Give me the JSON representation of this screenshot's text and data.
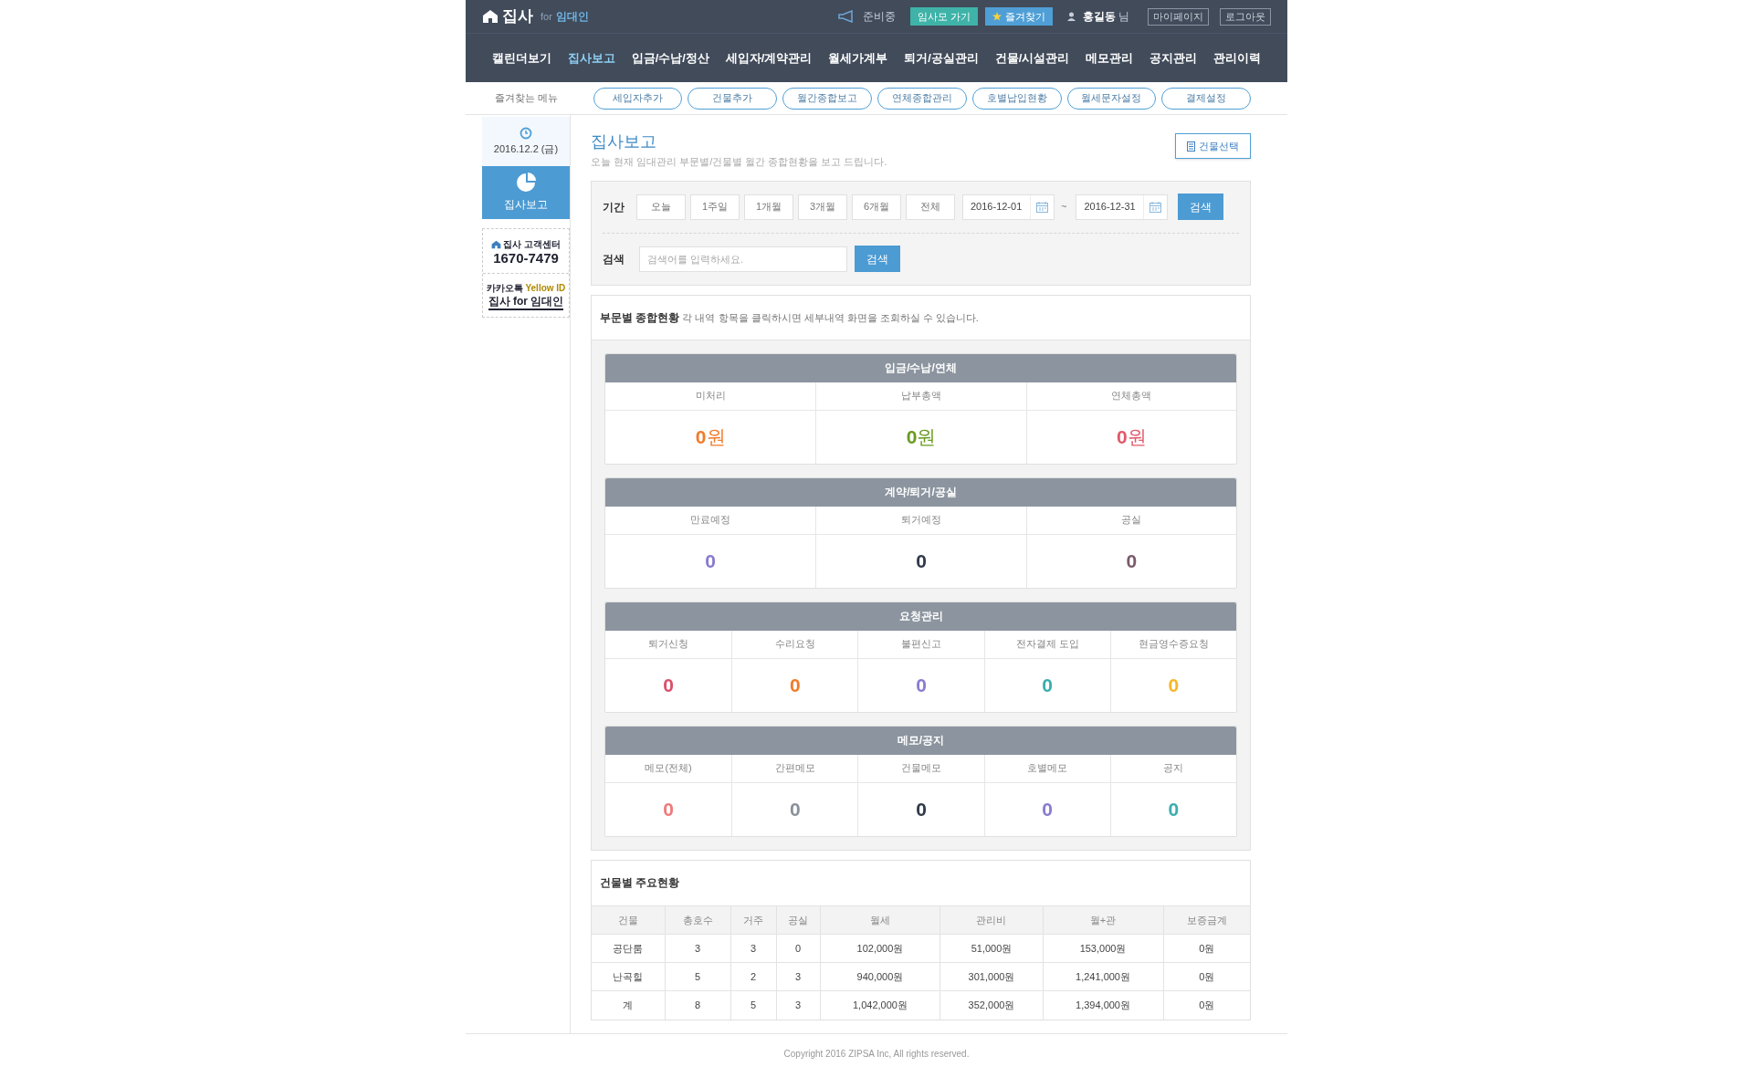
{
  "header": {
    "logo": {
      "main": "집사",
      "for": "for",
      "sub": "임대인"
    },
    "status": "준비중",
    "buttons": [
      {
        "label": "임사모 가기",
        "kind": "teal"
      },
      {
        "label": "즐겨찾기",
        "kind": "star"
      }
    ],
    "user": {
      "name": "홍길동",
      "suffix": "님"
    },
    "links": [
      "마이페이지",
      "로그아웃"
    ]
  },
  "nav": [
    {
      "label": "캘린더보기",
      "selected": false
    },
    {
      "label": "집사보고",
      "selected": true
    },
    {
      "label": "입금/수납/정산",
      "selected": false
    },
    {
      "label": "세입자/계약관리",
      "selected": false
    },
    {
      "label": "월세가계부",
      "selected": false
    },
    {
      "label": "퇴거/공실관리",
      "selected": false
    },
    {
      "label": "건물/시설관리",
      "selected": false
    },
    {
      "label": "메모관리",
      "selected": false
    },
    {
      "label": "공지관리",
      "selected": false
    },
    {
      "label": "관리이력",
      "selected": false
    }
  ],
  "favorites": {
    "label": "즐겨찾는 메뉴",
    "items": [
      "세입자추가",
      "건물추가",
      "월간종합보고",
      "연체종합관리",
      "호별납입현황",
      "월세문자설정",
      "결제설정"
    ]
  },
  "sidebar": {
    "date": "2016.12.2 (금)",
    "active": "집사보고",
    "ads": [
      {
        "kind": "center",
        "brand": "집사",
        "title": "고객센터",
        "phone": "1670-7479"
      },
      {
        "kind": "kakao",
        "title": "카카오톡",
        "highlight": "Yellow ID",
        "name": "집사 for 임대인"
      }
    ]
  },
  "page": {
    "title": "집사보고",
    "description": "오늘 현재 임대관리 부문별/건물별 월간 종합현황을 보고 드립니다.",
    "building_button": "건물선택"
  },
  "filter": {
    "period_label": "기간",
    "periods": [
      "오늘",
      "1주일",
      "1개월",
      "3개월",
      "6개월",
      "전체"
    ],
    "start": "2016-12-01",
    "sep": "~",
    "end": "2016-12-31",
    "period_button": "검색",
    "search_label": "검색",
    "search_placeholder": "검색어를 입력하세요.",
    "search_button": "검색"
  },
  "summary": {
    "title": "부문별 종합현황",
    "note": "각 내역 항목을 클릭하시면 세부내역 화면을 조회하실 수 있습니다.",
    "sections": [
      {
        "title": "입금/수납/연체",
        "items": [
          {
            "label": "미처리",
            "value": "**0**원",
            "color": "#f07c2a"
          },
          {
            "label": "납부총액",
            "value": "**0**원",
            "color": "#6a9a1f"
          },
          {
            "label": "연체총액",
            "value": "**0**원",
            "color": "#e05a6b"
          }
        ]
      },
      {
        "title": "계약/퇴거/공실",
        "items": [
          {
            "label": "만료예정",
            "value": "0",
            "color": "#8a7bd0"
          },
          {
            "label": "퇴거예정",
            "value": "0",
            "color": "#2f3a4a"
          },
          {
            "label": "공실",
            "value": "0",
            "color": "#7a5a6a"
          }
        ]
      },
      {
        "title": "요청관리",
        "items": [
          {
            "label": "퇴거신청",
            "value": "0",
            "color": "#d9506a"
          },
          {
            "label": "수리요청",
            "value": "0",
            "color": "#f07c2a"
          },
          {
            "label": "불편신고",
            "value": "0",
            "color": "#8a7bd0"
          },
          {
            "label": "전자결제 도입",
            "value": "0",
            "color": "#3aaeae"
          },
          {
            "label": "현금영수증요청",
            "value": "0",
            "color": "#f5b82a"
          }
        ]
      },
      {
        "title": "메모/공지",
        "items": [
          {
            "label": "메모(전체)",
            "value": "0",
            "color": "#f07a7a"
          },
          {
            "label": "간편메모",
            "value": "0",
            "color": "#8a919c"
          },
          {
            "label": "건물메모",
            "value": "0",
            "color": "#2f3a4a"
          },
          {
            "label": "호별메모",
            "value": "0",
            "color": "#8a7bd0"
          },
          {
            "label": "공지",
            "value": "0",
            "color": "#3aaeae"
          }
        ]
      }
    ]
  },
  "buildings": {
    "title": "건물별 주요현황",
    "columns": [
      "건물",
      "총호수",
      "거주",
      "공실",
      "월세",
      "관리비",
      "월+관",
      "보증금계"
    ],
    "rows": [
      [
        "공단룸",
        "3",
        "3",
        "0",
        "102,000원",
        "51,000원",
        "153,000원",
        "0원"
      ],
      [
        "난곡힐",
        "5",
        "2",
        "3",
        "940,000원",
        "301,000원",
        "1,241,000원",
        "0원"
      ],
      [
        "계",
        "8",
        "5",
        "3",
        "1,042,000원",
        "352,000원",
        "1,394,000원",
        "0원"
      ]
    ]
  },
  "footer": "Copyright 2016 ZIPSA Inc, All rights reserved."
}
